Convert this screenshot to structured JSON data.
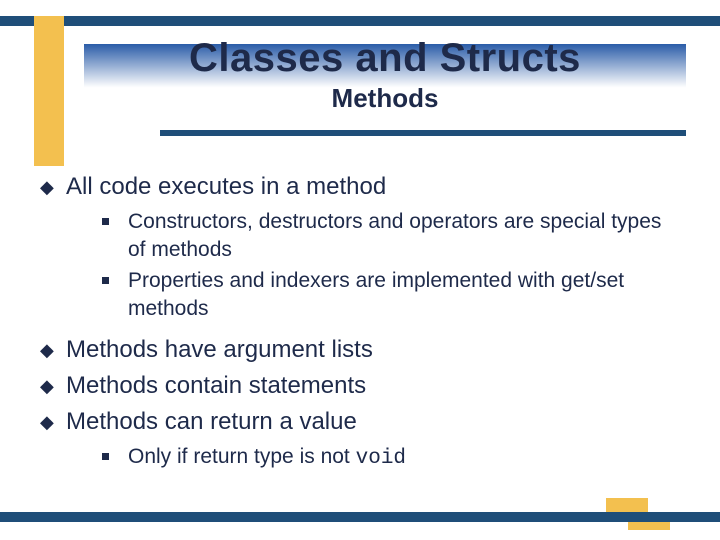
{
  "title": "Classes and Structs",
  "subtitle": "Methods",
  "bullets": [
    {
      "text": "All code executes in a method",
      "sub": [
        "Constructors, destructors and operators are special types of methods",
        "Properties and indexers are implemented with get/set methods"
      ]
    },
    {
      "text": "Methods have argument lists",
      "sub": []
    },
    {
      "text": "Methods contain statements",
      "sub": []
    },
    {
      "text": "Methods can return a value",
      "sub_has_code": true,
      "sub_prefix": "Only if return type is not ",
      "sub_code": "void"
    }
  ]
}
